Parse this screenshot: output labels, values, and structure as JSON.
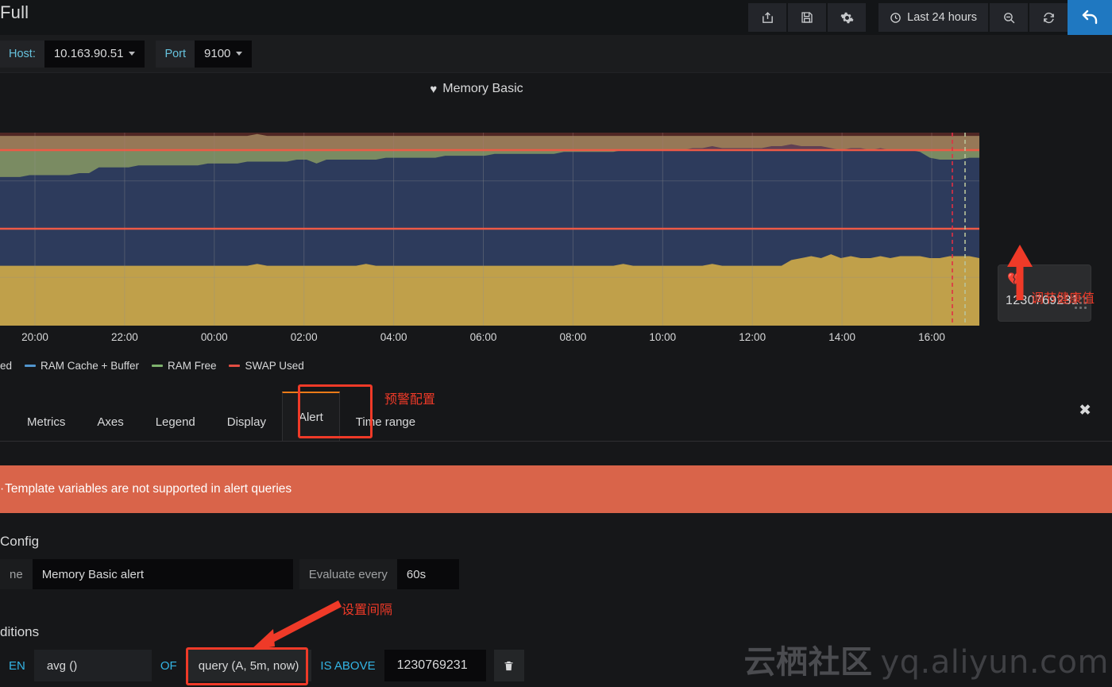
{
  "header": {
    "dashboard_title": "Full",
    "buttons": [
      {
        "name": "share-dashboard-button",
        "icon": "share-icon",
        "label": ""
      },
      {
        "name": "save-dashboard-button",
        "icon": "save-icon",
        "label": ""
      },
      {
        "name": "dashboard-settings-button",
        "icon": "gear-icon",
        "label": ""
      }
    ],
    "time_range": "Last 24 hours",
    "time_icon": "clock-icon",
    "zoom_out_label": "zoom-out-icon",
    "refresh_label": "refresh-icon",
    "back_label": "back-arrow-icon"
  },
  "variables": [
    {
      "label": "Host:",
      "value": "10.163.90.51"
    },
    {
      "label": "Port",
      "value": "9100"
    }
  ],
  "panel": {
    "title": "Memory Basic",
    "alert_icon": "heart-icon",
    "threshold_handle": {
      "value": "1230769231",
      "icon": "broken-heart-icon",
      "grip": "drag-grip-icon"
    }
  },
  "chart_data": {
    "type": "area",
    "title": "Memory Basic",
    "stacked": true,
    "xlabel": "",
    "ylabel": "",
    "xticks": [
      "20:00",
      "22:00",
      "00:00",
      "02:00",
      "04:00",
      "06:00",
      "08:00",
      "10:00",
      "12:00",
      "14:00",
      "16:00"
    ],
    "ylim": [
      0,
      100
    ],
    "grid": true,
    "legend_position": "bottom",
    "threshold": {
      "value": 1230769231,
      "op": "IS ABOVE",
      "color": "#ed5a46"
    },
    "series": [
      {
        "name": "RAM Used",
        "color": "#c0a04a",
        "values": [
          31,
          31,
          31,
          31,
          31,
          31,
          31,
          31,
          31,
          31,
          31,
          31,
          31,
          31,
          31,
          31,
          31,
          31,
          31,
          31,
          31,
          31,
          31,
          31,
          31,
          31,
          32,
          31,
          31,
          31,
          31,
          31,
          31,
          31,
          31,
          31,
          31,
          32,
          31,
          31,
          31,
          31,
          31,
          31,
          31,
          31,
          31,
          31,
          31,
          31,
          31,
          31,
          31,
          31,
          31,
          31,
          31,
          31,
          31,
          31,
          31,
          31,
          31,
          32,
          31,
          31,
          31,
          31,
          31,
          31,
          31,
          31,
          32,
          31,
          31,
          31,
          31,
          31,
          31,
          31,
          34,
          35,
          36,
          35,
          37,
          35,
          36,
          35,
          35,
          36,
          35,
          36,
          36,
          36,
          35,
          35,
          36,
          36,
          36,
          35
        ]
      },
      {
        "name": "RAM Cache + Buffer",
        "color": "#2d3b5c",
        "values": [
          46,
          46,
          46,
          47,
          47,
          47,
          47,
          47,
          48,
          48,
          51,
          51,
          51,
          51,
          52,
          52,
          52,
          52,
          52,
          52,
          52,
          53,
          53,
          53,
          53,
          54,
          53,
          54,
          54,
          54,
          55,
          55,
          53,
          55,
          55,
          55,
          55,
          54,
          55,
          56,
          56,
          56,
          56,
          56,
          56,
          57,
          57,
          57,
          57,
          57,
          58,
          58,
          58,
          58,
          58,
          58,
          58,
          59,
          59,
          59,
          59,
          59,
          59,
          59,
          60,
          60,
          60,
          60,
          60,
          60,
          61,
          61,
          61,
          61,
          61,
          61,
          61,
          61,
          62,
          62,
          60,
          58,
          57,
          58,
          55,
          56,
          56,
          57,
          56,
          56,
          56,
          55,
          55,
          54,
          52,
          51,
          50,
          50,
          51,
          52
        ]
      },
      {
        "name": "RAM Free",
        "color": "#7a8b62",
        "values": [
          21,
          21,
          21,
          20,
          20,
          20,
          20,
          20,
          19,
          19,
          16,
          16,
          16,
          16,
          15,
          15,
          15,
          15,
          15,
          15,
          15,
          14,
          14,
          14,
          14,
          13,
          14,
          13,
          13,
          13,
          12,
          12,
          14,
          12,
          12,
          12,
          12,
          12,
          12,
          11,
          11,
          11,
          11,
          11,
          11,
          10,
          10,
          10,
          10,
          10,
          9,
          9,
          9,
          9,
          9,
          9,
          9,
          8,
          8,
          8,
          8,
          8,
          8,
          7,
          7,
          7,
          7,
          7,
          7,
          7,
          6,
          6,
          5,
          6,
          6,
          6,
          6,
          6,
          5,
          5,
          4,
          5,
          5,
          5,
          6,
          7,
          6,
          6,
          7,
          6,
          7,
          7,
          7,
          8,
          11,
          12,
          12,
          12,
          11,
          11
        ]
      },
      {
        "name": "SWAP Used",
        "color": "#e24d42",
        "values": [
          0,
          0,
          0,
          0,
          0,
          0,
          0,
          0,
          0,
          0,
          0,
          0,
          0,
          0,
          0,
          0,
          0,
          0,
          0,
          0,
          0,
          0,
          0,
          0,
          0,
          0,
          0,
          0,
          0,
          0,
          0,
          0,
          0,
          0,
          0,
          0,
          0,
          0,
          0,
          0,
          0,
          0,
          0,
          0,
          0,
          0,
          0,
          0,
          0,
          0,
          0,
          0,
          0,
          0,
          0,
          0,
          0,
          0,
          0,
          0,
          0,
          0,
          0,
          0,
          0,
          0,
          0,
          0,
          0,
          0,
          0,
          0,
          0,
          0,
          0,
          0,
          0,
          0,
          0,
          0,
          0,
          0,
          0,
          0,
          0,
          0,
          0,
          0,
          0,
          0,
          0,
          0,
          0,
          0,
          0,
          0,
          0,
          0,
          0,
          0
        ]
      }
    ],
    "legend": [
      {
        "name": "RAM Used",
        "label_visible": "ed",
        "color": "#c0a04a"
      },
      {
        "name": "RAM Cache + Buffer",
        "label_visible": "RAM Cache + Buffer",
        "color": "#5195ce"
      },
      {
        "name": "RAM Free",
        "label_visible": "RAM Free",
        "color": "#7eb26d"
      },
      {
        "name": "SWAP Used",
        "label_visible": "SWAP Used",
        "color": "#e24d42"
      }
    ]
  },
  "editor": {
    "tabs": [
      {
        "label": "Metrics",
        "active": false
      },
      {
        "label": "Axes",
        "active": false
      },
      {
        "label": "Legend",
        "active": false
      },
      {
        "label": "Display",
        "active": false
      },
      {
        "label": "Alert",
        "active": true
      },
      {
        "label": "Time range",
        "active": false
      }
    ],
    "close_label": "✖"
  },
  "warning": {
    "text": "Template variables are not supported in alert queries",
    "bullet": "·"
  },
  "alert_config": {
    "section_title": "Config",
    "section_title_full": "Alert Config",
    "name_label": "ne",
    "name_label_full": "Name",
    "name_value": "Memory Basic alert",
    "evaluate_label": "Evaluate every",
    "evaluate_value": "60s"
  },
  "conditions": {
    "section_title": "ditions",
    "section_title_full": "Conditions",
    "when": "EN",
    "when_full": "WHEN",
    "reducer": "avg ()",
    "of": "OF",
    "query": "query (A, 5m, now)",
    "evaluator": "IS ABOVE",
    "threshold": "1230769231",
    "delete_icon": "trash-icon"
  },
  "annotations": [
    {
      "id": "threshold-note",
      "text": "调节健康值",
      "color": "#ef3a28"
    },
    {
      "id": "alert-tab-note",
      "text": "预警配置",
      "color": "#ef3a28"
    },
    {
      "id": "interval-note",
      "text": "设置间隔",
      "color": "#ef3a28"
    }
  ],
  "watermark": {
    "cn": "云栖社区",
    "url": "yq.aliyun.com"
  }
}
